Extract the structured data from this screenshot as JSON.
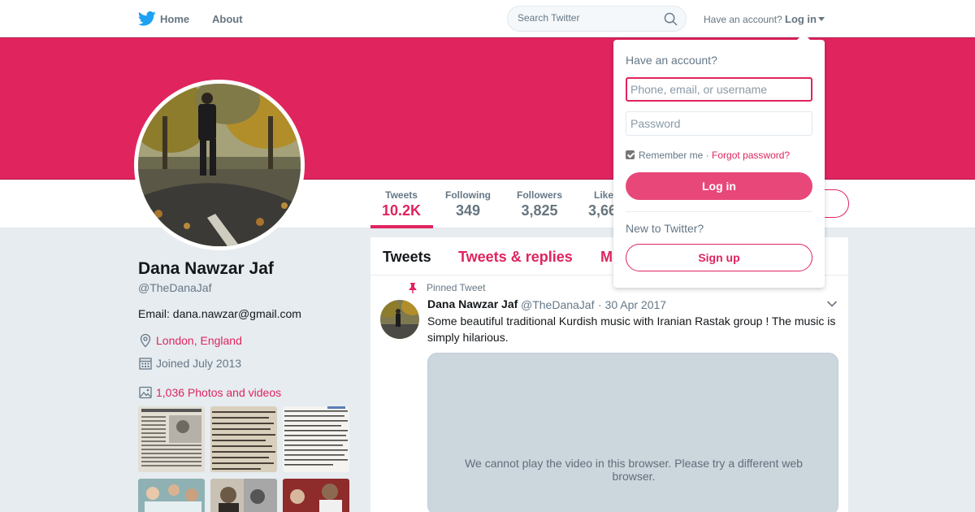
{
  "topnav": {
    "home_label": "Home",
    "about_label": "About",
    "search_placeholder": "Search Twitter",
    "have_account": "Have an account?",
    "login_label": "Log in"
  },
  "profile": {
    "name": "Dana Nawzar Jaf",
    "handle": "@TheDanaJaf",
    "bio": "Email: dana.nawzar@gmail.com",
    "location": "London, England",
    "joined": "Joined July 2013",
    "photos_label": "1,036 Photos and videos"
  },
  "stats": [
    {
      "label": "Tweets",
      "value": "10.2K"
    },
    {
      "label": "Following",
      "value": "349"
    },
    {
      "label": "Followers",
      "value": "3,825"
    },
    {
      "label": "Likes",
      "value": "3,66"
    }
  ],
  "timeline": {
    "tabs": [
      "Tweets",
      "Tweets & replies",
      "M"
    ],
    "pinned_label": "Pinned Tweet",
    "tweet": {
      "name": "Dana Nawzar Jaf",
      "handle": "@TheDanaJaf",
      "date": "· 30 Apr 2017",
      "text": "Some beautiful traditional Kurdish music with Iranian Rastak group ! The music is simply hilarious.",
      "video_message": "We cannot play the video in this browser. Please try a different web browser."
    }
  },
  "login_dropdown": {
    "title": "Have an account?",
    "username_placeholder": "Phone, email, or username",
    "password_placeholder": "Password",
    "remember_me": "Remember me",
    "separator": "·",
    "forgot_password": "Forgot password?",
    "login_button": "Log in",
    "new_to_twitter": "New to Twitter?",
    "signup_button": "Sign up"
  },
  "colors": {
    "accent": "#e0245e",
    "text_secondary": "#657786",
    "background": "#e6ecf0"
  },
  "icons": [
    "twitter-bird-icon",
    "search-icon",
    "location-icon",
    "calendar-icon",
    "photo-icon",
    "pin-icon",
    "chevron-down-icon"
  ]
}
